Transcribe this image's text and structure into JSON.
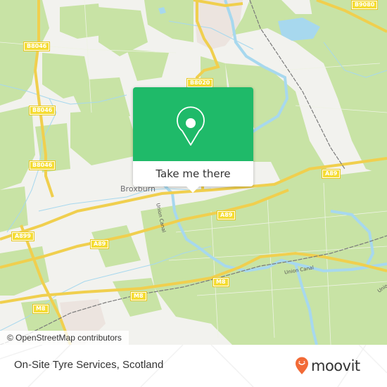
{
  "map": {
    "road_shields": [
      {
        "id": "b8046-1",
        "label": "B8046"
      },
      {
        "id": "b8046-2",
        "label": "B8046"
      },
      {
        "id": "b8046-3",
        "label": "B8046"
      },
      {
        "id": "b8046-4",
        "label": "B8046"
      },
      {
        "id": "b8020",
        "label": "B8020"
      },
      {
        "id": "b9080",
        "label": "B9080"
      },
      {
        "id": "a89-1",
        "label": "A89"
      },
      {
        "id": "a89-2",
        "label": "A89"
      },
      {
        "id": "a89-3",
        "label": "A89"
      },
      {
        "id": "a899",
        "label": "A899"
      },
      {
        "id": "m8-1",
        "label": "M8"
      },
      {
        "id": "m8-2",
        "label": "M8"
      },
      {
        "id": "m8-3",
        "label": "M8"
      }
    ],
    "places": {
      "broxburn": "Broxburn"
    },
    "waterways": {
      "union_canal_1": "Union Canal",
      "union_canal_2": "Union Canal",
      "union_canal_3": "Unio"
    },
    "colors": {
      "land": "#f2f2ee",
      "green": "#c8e3a5",
      "water": "#a7d8ee",
      "road_major": "#f5dc6e",
      "rail": "#7a7a7a",
      "urban": "#ece4df"
    }
  },
  "popup": {
    "icon": "location-pin-icon",
    "button_label": "Take me there",
    "color": "#1fba69"
  },
  "attribution": "© OpenStreetMap contributors",
  "footer": {
    "title": "On-Site Tyre Services, Scotland",
    "brand": "moovit",
    "brand_color": "#f26a36"
  }
}
